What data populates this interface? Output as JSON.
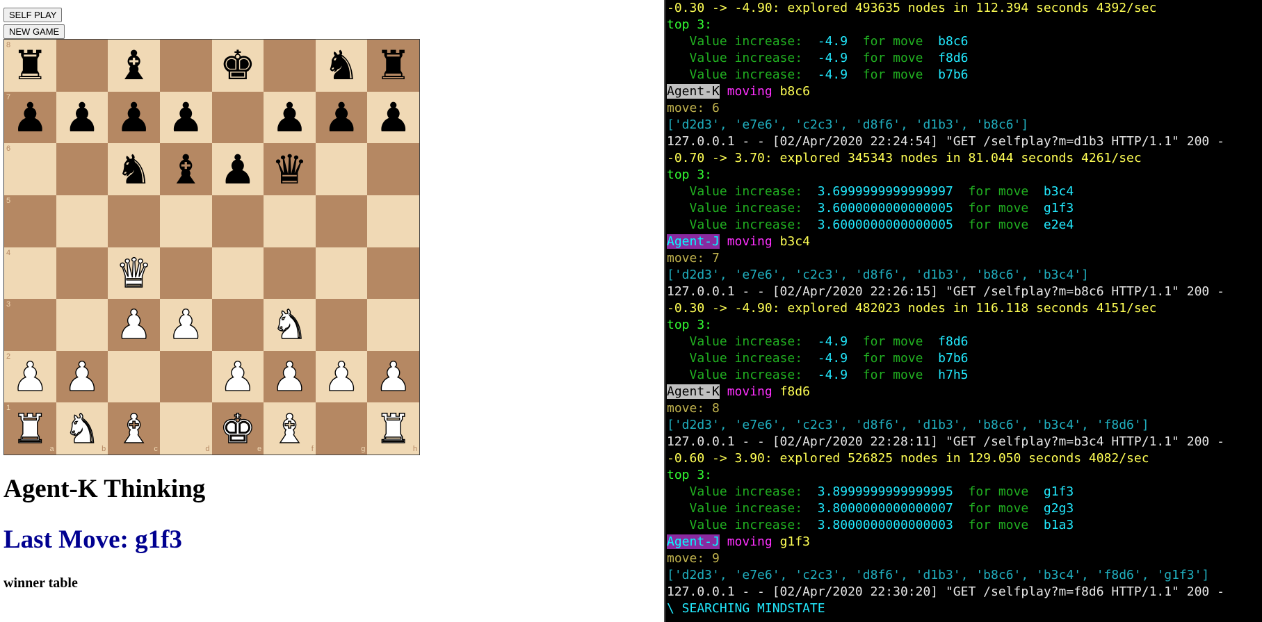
{
  "controls": {
    "self_play_label": "SELF PLAY",
    "new_game_label": "NEW GAME"
  },
  "board": {
    "light_color": "#f0d9b5",
    "dark_color": "#b58863",
    "files": [
      "a",
      "b",
      "c",
      "d",
      "e",
      "f",
      "g",
      "h"
    ],
    "ranks": [
      "8",
      "7",
      "6",
      "5",
      "4",
      "3",
      "2",
      "1"
    ],
    "position": [
      [
        "r",
        "",
        "b",
        "",
        "k",
        "",
        "n",
        "r"
      ],
      [
        "p",
        "p",
        "p",
        "p",
        "",
        "p",
        "p",
        "p"
      ],
      [
        "",
        "",
        "n",
        "b",
        "p",
        "q",
        "",
        ""
      ],
      [
        "",
        "",
        "",
        "",
        "",
        "",
        "",
        ""
      ],
      [
        "",
        "",
        "Q",
        "",
        "",
        "",
        "",
        ""
      ],
      [
        "",
        "",
        "P",
        "P",
        "",
        "N",
        "",
        ""
      ],
      [
        "P",
        "P",
        "",
        "",
        "P",
        "P",
        "P",
        "P"
      ],
      [
        "R",
        "N",
        "B",
        "",
        "K",
        "B",
        "",
        "R"
      ]
    ]
  },
  "status_text": "Agent-K Thinking",
  "last_move_text": "Last Move: g1f3",
  "winner_table_label": "winner table",
  "terminal": {
    "lines": [
      {
        "type": "eval",
        "text": "-0.30 -> -4.90: explored 493635 nodes in 112.394 seconds 4392/sec"
      },
      {
        "type": "top",
        "text": "top 3:"
      },
      {
        "type": "value",
        "label": "   Value increase:  ",
        "value": "-4.9",
        "sep": "  for move  ",
        "move": "b8c6"
      },
      {
        "type": "value",
        "label": "   Value increase:  ",
        "value": "-4.9",
        "sep": "  for move  ",
        "move": "f8d6"
      },
      {
        "type": "value",
        "label": "   Value increase:  ",
        "value": "-4.9",
        "sep": "  for move  ",
        "move": "b7b6"
      },
      {
        "type": "agent",
        "agent": "Agent-K",
        "verb": " moving ",
        "move": "b8c6"
      },
      {
        "type": "move",
        "text": "move: 6"
      },
      {
        "type": "list",
        "text": "['d2d3', 'e7e6', 'c2c3', 'd8f6', 'd1b3', 'b8c6']"
      },
      {
        "type": "http",
        "text": "127.0.0.1 - - [02/Apr/2020 22:24:54] \"GET /selfplay?m=d1b3 HTTP/1.1\" 200 -"
      },
      {
        "type": "eval",
        "text": "-0.70 -> 3.70: explored 345343 nodes in 81.044 seconds 4261/sec"
      },
      {
        "type": "top",
        "text": "top 3:"
      },
      {
        "type": "value",
        "label": "   Value increase:  ",
        "value": "3.6999999999999997",
        "sep": "  for move  ",
        "move": "b3c4"
      },
      {
        "type": "value",
        "label": "   Value increase:  ",
        "value": "3.6000000000000005",
        "sep": "  for move  ",
        "move": "g1f3"
      },
      {
        "type": "value",
        "label": "   Value increase:  ",
        "value": "3.6000000000000005",
        "sep": "  for move  ",
        "move": "e2e4"
      },
      {
        "type": "agent",
        "agent": "Agent-J",
        "verb": " moving ",
        "move": "b3c4"
      },
      {
        "type": "move",
        "text": "move: 7"
      },
      {
        "type": "list",
        "text": "['d2d3', 'e7e6', 'c2c3', 'd8f6', 'd1b3', 'b8c6', 'b3c4']"
      },
      {
        "type": "http",
        "text": "127.0.0.1 - - [02/Apr/2020 22:26:15] \"GET /selfplay?m=b8c6 HTTP/1.1\" 200 -"
      },
      {
        "type": "eval",
        "text": "-0.30 -> -4.90: explored 482023 nodes in 116.118 seconds 4151/sec"
      },
      {
        "type": "top",
        "text": "top 3:"
      },
      {
        "type": "value",
        "label": "   Value increase:  ",
        "value": "-4.9",
        "sep": "  for move  ",
        "move": "f8d6"
      },
      {
        "type": "value",
        "label": "   Value increase:  ",
        "value": "-4.9",
        "sep": "  for move  ",
        "move": "b7b6"
      },
      {
        "type": "value",
        "label": "   Value increase:  ",
        "value": "-4.9",
        "sep": "  for move  ",
        "move": "h7h5"
      },
      {
        "type": "agent",
        "agent": "Agent-K",
        "verb": " moving ",
        "move": "f8d6"
      },
      {
        "type": "move",
        "text": "move: 8"
      },
      {
        "type": "list",
        "text": "['d2d3', 'e7e6', 'c2c3', 'd8f6', 'd1b3', 'b8c6', 'b3c4', 'f8d6']"
      },
      {
        "type": "http",
        "text": "127.0.0.1 - - [02/Apr/2020 22:28:11] \"GET /selfplay?m=b3c4 HTTP/1.1\" 200 -"
      },
      {
        "type": "eval",
        "text": "-0.60 -> 3.90: explored 526825 nodes in 129.050 seconds 4082/sec"
      },
      {
        "type": "top",
        "text": "top 3:"
      },
      {
        "type": "value",
        "label": "   Value increase:  ",
        "value": "3.8999999999999995",
        "sep": "  for move  ",
        "move": "g1f3"
      },
      {
        "type": "value",
        "label": "   Value increase:  ",
        "value": "3.8000000000000007",
        "sep": "  for move  ",
        "move": "g2g3"
      },
      {
        "type": "value",
        "label": "   Value increase:  ",
        "value": "3.8000000000000003",
        "sep": "  for move  ",
        "move": "b1a3"
      },
      {
        "type": "agent",
        "agent": "Agent-J",
        "verb": " moving ",
        "move": "g1f3"
      },
      {
        "type": "move",
        "text": "move: 9"
      },
      {
        "type": "list",
        "text": "['d2d3', 'e7e6', 'c2c3', 'd8f6', 'd1b3', 'b8c6', 'b3c4', 'f8d6', 'g1f3']"
      },
      {
        "type": "http",
        "text": "127.0.0.1 - - [02/Apr/2020 22:30:20] \"GET /selfplay?m=f8d6 HTTP/1.1\" 200 -"
      },
      {
        "type": "search",
        "text": "\\ SEARCHING MINDSTATE"
      }
    ]
  }
}
